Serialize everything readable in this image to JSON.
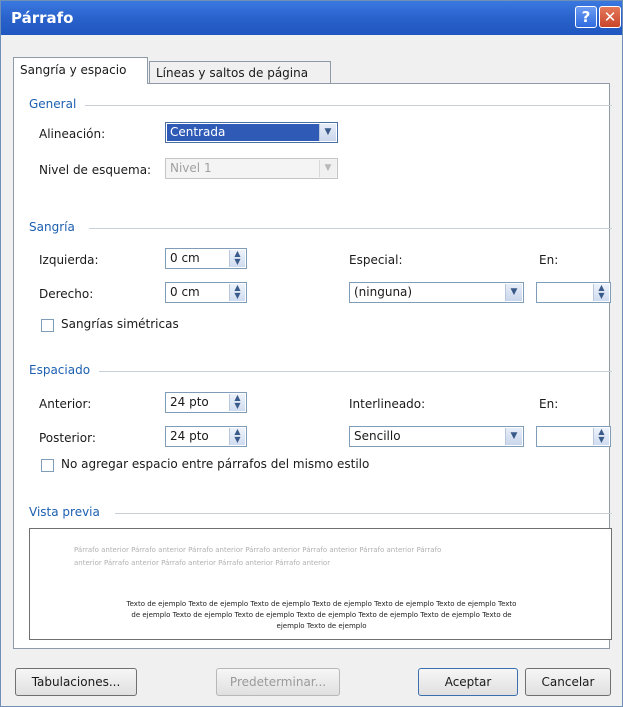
{
  "window": {
    "title": "Párrafo",
    "help_glyph": "?",
    "close_glyph": "✕"
  },
  "tabs": [
    {
      "label": "Sangría y espacio"
    },
    {
      "label": "Líneas y saltos de página"
    }
  ],
  "general": {
    "heading": "General",
    "alignment_label": "Alineación:",
    "alignment_value": "Centrada",
    "outline_label": "Nivel de esquema:",
    "outline_value": "Nivel 1"
  },
  "indent": {
    "heading": "Sangría",
    "left_label": "Izquierda:",
    "left_value": "0 cm",
    "right_label": "Derecho:",
    "right_value": "0 cm",
    "special_label": "Especial:",
    "special_value": "(ninguna)",
    "by_label": "En:",
    "by_value": "",
    "mirror_label": "Sangrías simétricas"
  },
  "spacing": {
    "heading": "Espaciado",
    "before_label": "Anterior:",
    "before_value": "24 pto",
    "after_label": "Posterior:",
    "after_value": "24 pto",
    "line_label": "Interlineado:",
    "line_value": "Sencillo",
    "at_label": "En:",
    "at_value": "",
    "no_space_label": "No agregar espacio entre párrafos del mismo estilo"
  },
  "preview": {
    "heading": "Vista previa",
    "prev_line1": "Párrafo anterior Párrafo anterior Párrafo anterior Párrafo anterior Párrafo anterior Párrafo anterior Párrafo",
    "prev_line2": "anterior Párrafo anterior Párrafo anterior Párrafo anterior Párrafo anterior",
    "sample_line1": "Texto de ejemplo Texto de ejemplo Texto de ejemplo Texto de ejemplo Texto de ejemplo Texto de ejemplo Texto",
    "sample_line2": "de ejemplo Texto de ejemplo Texto de ejemplo Texto de ejemplo Texto de ejemplo Texto de ejemplo Texto de",
    "sample_line3": "ejemplo Texto de ejemplo"
  },
  "buttons": {
    "tabs_label": "Tabulaciones...",
    "default_label": "Predeterminar...",
    "ok_label": "Aceptar",
    "cancel_label": "Cancelar"
  }
}
